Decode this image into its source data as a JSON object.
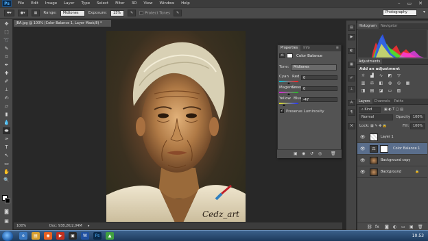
{
  "menubar": {
    "logo": "Ps",
    "items": [
      "File",
      "Edit",
      "Image",
      "Layer",
      "Type",
      "Select",
      "Filter",
      "3D",
      "View",
      "Window",
      "Help"
    ],
    "window_controls": [
      "–",
      "▭",
      "✕"
    ]
  },
  "options": {
    "range_label": "Range:",
    "range_value": "Midtones",
    "exposure_label": "Exposure:",
    "exposure_value": "15%",
    "protect_tones": "Protect Tones",
    "workspace": "Photography"
  },
  "document": {
    "tab_title": "JBA.jpg @ 100% (Color Balance 1, Layer Mask/8) *",
    "zoom": "100%",
    "doc_size": "Doc: 938,2K/2,04M",
    "signature": "Cedz_art"
  },
  "properties": {
    "tabs": [
      "Properties",
      "Info"
    ],
    "title": "Color Balance",
    "tone_label": "Tone:",
    "tone_value": "Midtones",
    "sliders": [
      {
        "left": "Cyan",
        "right": "Red",
        "value": "0",
        "position": 0.5
      },
      {
        "left": "Magenta",
        "right": "Green",
        "value": "0",
        "position": 0.5
      },
      {
        "left": "Yellow",
        "right": "Blue",
        "value": "-47",
        "position": 0.265
      }
    ],
    "preserve_luminosity": "Preserve Luminosity",
    "preserve_checked": true
  },
  "right": {
    "histogram_tabs": [
      "Histogram",
      "Navigator"
    ],
    "adjustments_tab": "Adjustments",
    "add_adjustment": "Add an adjustment",
    "layers_tabs": [
      "Layers",
      "Channels",
      "Paths"
    ],
    "kind": "Kind",
    "blend_mode": "Normal",
    "opacity_label": "Opacity:",
    "opacity_value": "100%",
    "lock_label": "Lock:",
    "fill_label": "Fill:",
    "fill_value": "100%",
    "layers": [
      {
        "name": "Layer 1",
        "selected": false
      },
      {
        "name": "Color Balance 1",
        "selected": true
      },
      {
        "name": "Background copy",
        "selected": false
      },
      {
        "name": "Background",
        "selected": false
      }
    ]
  },
  "taskbar": {
    "time": "10:53"
  },
  "colors": {
    "ps_blue": "#4fb2ff",
    "selection": "#5a6e8c",
    "cyan_red_track": "#00b4c8",
    "magenta_green_track": "#c800c8",
    "yellow_blue_track": "#c8c800"
  }
}
